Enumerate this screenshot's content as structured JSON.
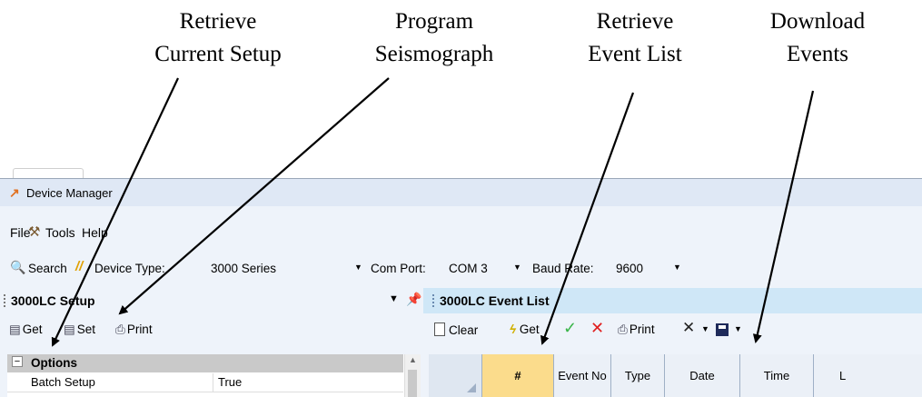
{
  "annotations": {
    "retrieve_setup": [
      "Retrieve",
      "Current Setup"
    ],
    "program": [
      "Program",
      "Seismograph"
    ],
    "retrieve_events": [
      "Retrieve",
      "Event List"
    ],
    "download": [
      "Download",
      "Events"
    ]
  },
  "window": {
    "title": "Device Manager"
  },
  "menu": {
    "file": "File",
    "tools": "Tools",
    "help": "Help"
  },
  "toolbar": {
    "search": "Search",
    "device_type_label": "Device Type:",
    "device_type_value": "3000 Series",
    "com_port_label": "Com Port:",
    "com_port_value": "COM 3",
    "baud_rate_label": "Baud Rate:",
    "baud_rate_value": "9600"
  },
  "setup_pane": {
    "title": "3000LC Setup",
    "get": "Get",
    "set": "Set",
    "print": "Print",
    "options_header": "Options",
    "rows": [
      {
        "name": "Batch Setup",
        "value": "True"
      }
    ]
  },
  "event_pane": {
    "title": "3000LC Event List",
    "clear": "Clear",
    "get": "Get",
    "print": "Print",
    "columns": [
      "#",
      "Event No",
      "Type",
      "Date",
      "Time",
      "L"
    ]
  },
  "icons": [
    "tools-icon",
    "binoculars-icon",
    "device-type-icon",
    "pin-icon",
    "get-icon",
    "set-icon",
    "printer-icon",
    "lightning-icon",
    "check-icon",
    "red-x-icon",
    "delete-icon",
    "floppy-icon"
  ],
  "colors": {
    "active_column": "#fbdc8c",
    "event_header": "#cfe7f7",
    "app_icon": "#e07020"
  }
}
